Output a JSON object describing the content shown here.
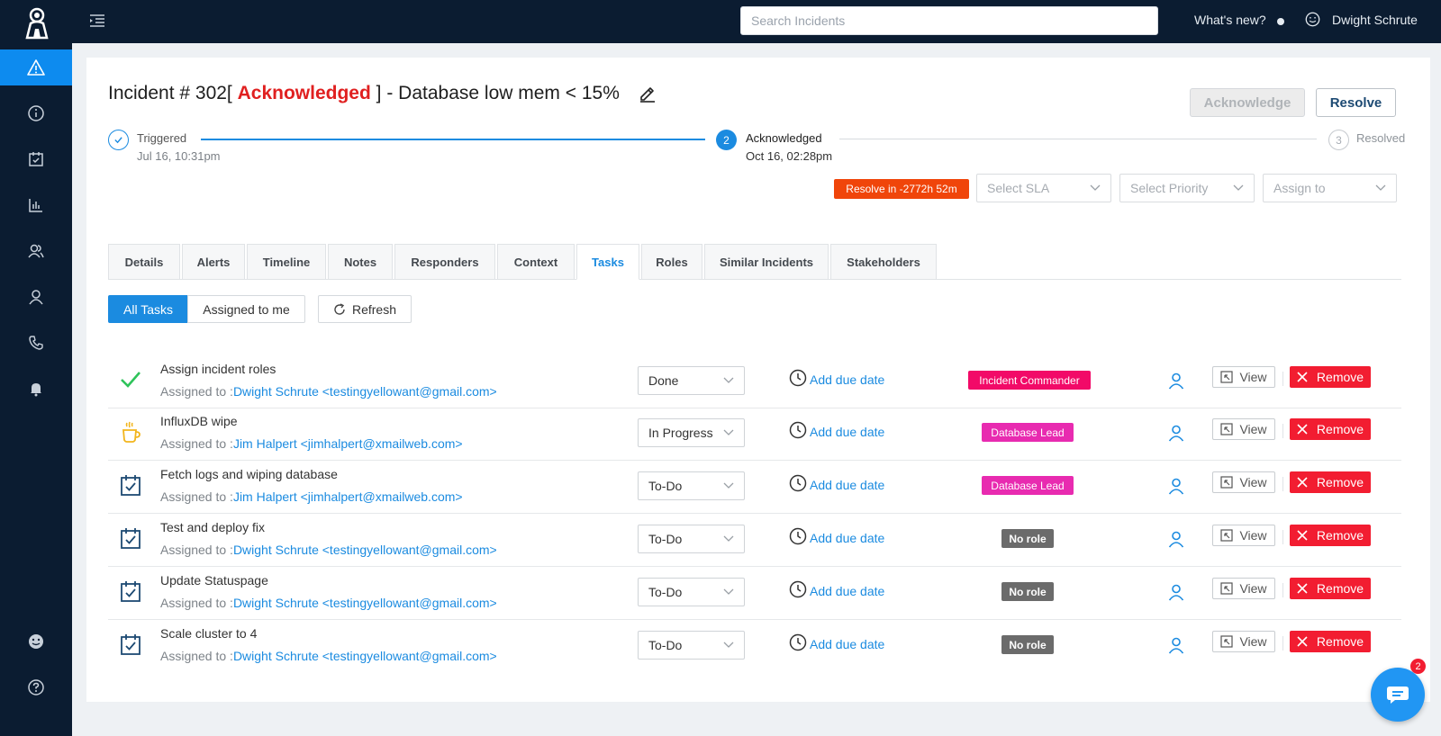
{
  "topbar": {
    "search_placeholder": "Search Incidents",
    "whats_new": "What's new?",
    "user_name": "Dwight Schrute"
  },
  "incident": {
    "title_prefix": "Incident # 302[",
    "status": "Acknowledged",
    "title_suffix": "] - Database low mem < 15%",
    "acknowledge_label": "Acknowledge",
    "resolve_label": "Resolve"
  },
  "steps": [
    {
      "label": "Triggered",
      "date": "Jul 16, 10:31pm"
    },
    {
      "number": "2",
      "label": "Acknowledged",
      "date": "Oct 16, 02:28pm"
    },
    {
      "number": "3",
      "label": "Resolved"
    }
  ],
  "sla_badge": "Resolve in -2772h 52m",
  "dropdowns": {
    "sla": "Select SLA",
    "priority": "Select Priority",
    "assign": "Assign to"
  },
  "tabs": [
    "Details",
    "Alerts",
    "Timeline",
    "Notes",
    "Responders",
    "Context",
    "Tasks",
    "Roles",
    "Similar Incidents",
    "Stakeholders"
  ],
  "filters": {
    "all_tasks": "All Tasks",
    "assigned_to_me": "Assigned to me",
    "refresh": "Refresh"
  },
  "tasks": [
    {
      "title": "Assign incident roles",
      "assigned_prefix": "Assigned to :",
      "assignee": "Dwight Schrute <testingyellowant@gmail.com>",
      "status": "Done",
      "due": "Add due date",
      "role": "Incident Commander",
      "icon": "check-icon"
    },
    {
      "title": "InfluxDB wipe",
      "assigned_prefix": "Assigned to :",
      "assignee": "Jim Halpert <jimhalpert@xmailweb.com>",
      "status": "In Progress",
      "due": "Add due date",
      "role": "Database Lead",
      "icon": "coffee-icon"
    },
    {
      "title": "Fetch logs and wiping database",
      "assigned_prefix": "Assigned to :",
      "assignee": "Jim Halpert <jimhalpert@xmailweb.com>",
      "status": "To-Do",
      "due": "Add due date",
      "role": "Database Lead",
      "icon": "calendar-check-icon"
    },
    {
      "title": "Test and deploy fix",
      "assigned_prefix": "Assigned to :",
      "assignee": "Dwight Schrute <testingyellowant@gmail.com>",
      "status": "To-Do",
      "due": "Add due date",
      "role": "No role",
      "icon": "calendar-check-icon"
    },
    {
      "title": "Update Statuspage",
      "assigned_prefix": "Assigned to :",
      "assignee": "Dwight Schrute <testingyellowant@gmail.com>",
      "status": "To-Do",
      "due": "Add due date",
      "role": "No role",
      "icon": "calendar-check-icon"
    },
    {
      "title": "Scale cluster to 4",
      "assigned_prefix": "Assigned to :",
      "assignee": "Dwight Schrute <testingyellowant@gmail.com>",
      "status": "To-Do",
      "due": "Add due date",
      "role": "No role",
      "icon": "calendar-check-icon"
    }
  ],
  "actions": {
    "view": "View",
    "remove": "Remove"
  },
  "chat_badge": "2",
  "colors": {
    "navy": "#0b1c31",
    "accent": "#1b8be0",
    "status_red": "#e02020",
    "sla_orange": "#f0450a",
    "remove_red": "#f21d31",
    "role_commander": "#f20a68",
    "role_db": "#e82bb0",
    "role_none": "#6b6b6b"
  }
}
